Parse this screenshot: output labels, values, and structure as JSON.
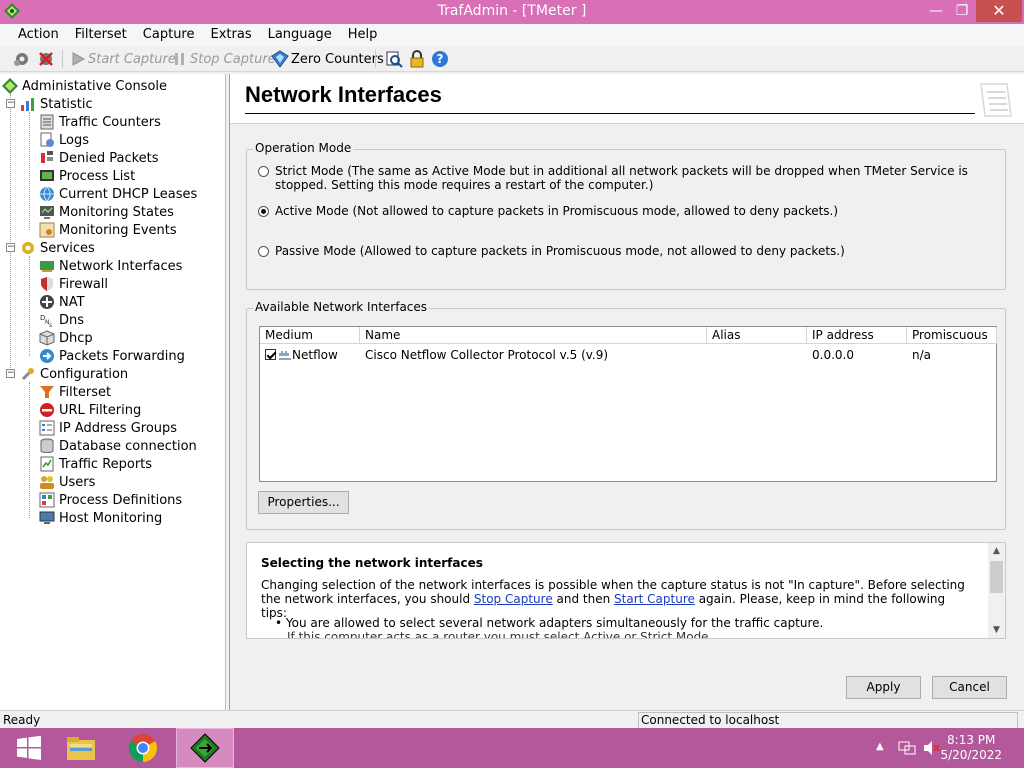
{
  "window": {
    "title": "TrafAdmin - [TMeter ]",
    "minimize": "—",
    "restore": "❐",
    "close": "✕"
  },
  "menu": [
    "Action",
    "Filterset",
    "Capture",
    "Extras",
    "Language",
    "Help"
  ],
  "toolbar": {
    "start_capture": "Start Capture",
    "stop_capture": "Stop Capture",
    "zero_counters": "Zero Counters"
  },
  "tree": {
    "root": "Administative Console",
    "statistic": "Statistic",
    "statistic_items": [
      "Traffic Counters",
      "Logs",
      "Denied Packets",
      "Process List",
      "Current DHCP Leases",
      "Monitoring States",
      "Monitoring Events"
    ],
    "services": "Services",
    "services_items": [
      "Network Interfaces",
      "Firewall",
      "NAT",
      "Dns",
      "Dhcp",
      "Packets Forwarding"
    ],
    "configuration": "Configuration",
    "configuration_items": [
      "Filterset",
      "URL Filtering",
      "IP Address Groups",
      "Database connection",
      "Traffic Reports",
      "Users",
      "Process Definitions",
      "Host Monitoring"
    ]
  },
  "page": {
    "title": "Network Interfaces"
  },
  "operation_mode": {
    "title": "Operation Mode",
    "strict": "Strict Mode (The same as Active Mode but in additional all network packets will be dropped when TMeter Service is stopped. Setting this mode requires a restart of the computer.)",
    "active": "Active Mode (Not allowed to capture packets in Promiscuous mode, allowed to deny packets.)",
    "passive": "Passive Mode (Allowed to capture packets in Promiscuous mode, not allowed to deny packets.)",
    "selected": "active"
  },
  "interfaces": {
    "title": "Available Network Interfaces",
    "columns": [
      "Medium",
      "Name",
      "Alias",
      "IP address",
      "Promiscuous"
    ],
    "rows": [
      {
        "medium": "Netflow",
        "name": "Cisco Netflow Collector Protocol v.5 (v.9)",
        "alias": "",
        "ip": "0.0.0.0",
        "promiscuous": "n/a",
        "checked": true
      }
    ],
    "properties_button": "Properties..."
  },
  "help": {
    "heading": "Selecting the network interfaces",
    "p1": "Changing selection of the network interfaces is possible when the capture status is not \"In capture\". Before selecting the network interfaces, you should ",
    "link1": "Stop Capture",
    "p2": " and then ",
    "link2": "Start Capture",
    "p3": " again. Please, keep in mind the following tips:",
    "bullet1": "You are allowed to select several network adapters simultaneously for the traffic capture.",
    "bullet2": "If this computer acts as a router you must select Active or Strict Mode..."
  },
  "buttons": {
    "apply": "Apply",
    "cancel": "Cancel"
  },
  "status": {
    "left": "Ready",
    "right": "Connected to localhost"
  },
  "taskbar": {
    "time": "8:13 PM",
    "date": "5/20/2022"
  },
  "colors": {
    "titlebar": "#d86fb7",
    "taskbar": "#b3589a",
    "link": "#1a3dbd"
  }
}
